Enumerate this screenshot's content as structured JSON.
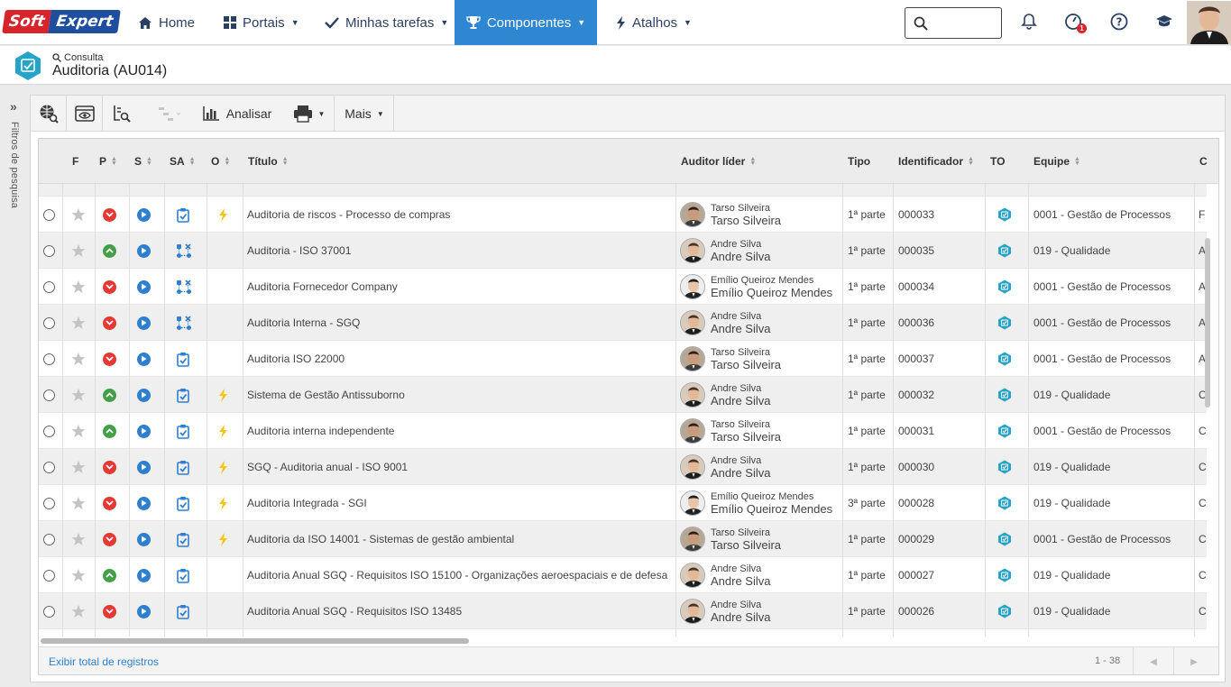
{
  "brand": {
    "part1": "Soft",
    "part2": "Expert"
  },
  "nav": [
    {
      "label": "Home",
      "icon": "home-icon"
    },
    {
      "label": "Portais",
      "icon": "grid-icon"
    },
    {
      "label": "Minhas tarefas",
      "icon": "check-icon"
    },
    {
      "label": "Componentes",
      "icon": "trophy-icon"
    },
    {
      "label": "Atalhos",
      "icon": "bolt-icon"
    }
  ],
  "notifications_badge": "1",
  "breadcrumb": {
    "sub": "Consulta",
    "title": "Auditoria (AU014)"
  },
  "left_rail": {
    "label": "Filtros de pesquisa"
  },
  "toolbar": {
    "analyze": "Analisar",
    "more": "Mais"
  },
  "columns": [
    "F",
    "P",
    "S",
    "SA",
    "O",
    "Título",
    "Auditor líder",
    "Tipo",
    "Identificador",
    "TO",
    "Equipe",
    "C"
  ],
  "rows": [
    {
      "p": "red",
      "sa": "clipboard-check",
      "o": true,
      "title": "Auditoria de riscos - Processo de compras",
      "auditor": "Tarso Silveira",
      "tipo": "1ª parte",
      "id": "000033",
      "equipe": "0001 - Gestão de Processos",
      "c": "F"
    },
    {
      "p": "green",
      "sa": "network",
      "o": false,
      "title": "Auditoria - ISO 37001",
      "auditor": "Andre Silva",
      "tipo": "1ª parte",
      "id": "000035",
      "equipe": "019 - Qualidade",
      "c": "A"
    },
    {
      "p": "red",
      "sa": "network",
      "o": false,
      "title": "Auditoria Fornecedor Company",
      "auditor": "Emílio Queiroz Mendes",
      "tipo": "1ª parte",
      "id": "000034",
      "equipe": "0001 - Gestão de Processos",
      "c": "A"
    },
    {
      "p": "red",
      "sa": "network",
      "o": false,
      "title": "Auditoria Interna - SGQ",
      "auditor": "Andre Silva",
      "tipo": "1ª parte",
      "id": "000036",
      "equipe": "0001 - Gestão de Processos",
      "c": "A"
    },
    {
      "p": "red",
      "sa": "clipboard-check",
      "o": false,
      "title": "Auditoria ISO 22000",
      "auditor": "Tarso Silveira",
      "tipo": "1ª parte",
      "id": "000037",
      "equipe": "0001 - Gestão de Processos",
      "c": "A"
    },
    {
      "p": "green",
      "sa": "clipboard-check",
      "o": true,
      "title": "Sistema de Gestão Antissuborno",
      "auditor": "Andre Silva",
      "tipo": "1ª parte",
      "id": "000032",
      "equipe": "019 - Qualidade",
      "c": "C"
    },
    {
      "p": "green",
      "sa": "clipboard-check",
      "o": true,
      "title": "Auditoria interna independente",
      "auditor": "Tarso Silveira",
      "tipo": "1ª parte",
      "id": "000031",
      "equipe": "0001 - Gestão de Processos",
      "c": "C"
    },
    {
      "p": "red",
      "sa": "clipboard-check",
      "o": true,
      "title": "SGQ - Auditoria anual - ISO 9001",
      "auditor": "Andre Silva",
      "tipo": "1ª parte",
      "id": "000030",
      "equipe": "019 - Qualidade",
      "c": "C"
    },
    {
      "p": "red",
      "sa": "clipboard-check",
      "o": true,
      "title": "Auditoria Integrada - SGI",
      "auditor": "Emílio Queiroz Mendes",
      "tipo": "3ª parte",
      "id": "000028",
      "equipe": "019 - Qualidade",
      "c": "C"
    },
    {
      "p": "red",
      "sa": "clipboard-check",
      "o": true,
      "title": "Auditoria da ISO 14001 - Sistemas de gestão ambiental",
      "auditor": "Tarso Silveira",
      "tipo": "1ª parte",
      "id": "000029",
      "equipe": "0001 - Gestão de Processos",
      "c": "C"
    },
    {
      "p": "green",
      "sa": "clipboard-check",
      "o": false,
      "title": "Auditoria Anual SGQ - Requisitos ISO 15100 - Organizações aeroespaciais e de defesa",
      "auditor": "Andre Silva",
      "tipo": "1ª parte",
      "id": "000027",
      "equipe": "019 - Qualidade",
      "c": "C"
    },
    {
      "p": "red",
      "sa": "clipboard-check",
      "o": false,
      "title": "Auditoria Anual SGQ - Requisitos ISO 13485",
      "auditor": "Andre Silva",
      "tipo": "1ª parte",
      "id": "000026",
      "equipe": "019 - Qualidade",
      "c": "C"
    }
  ],
  "footer": {
    "total_link": "Exibir total de registros",
    "range": "1 - 38"
  }
}
